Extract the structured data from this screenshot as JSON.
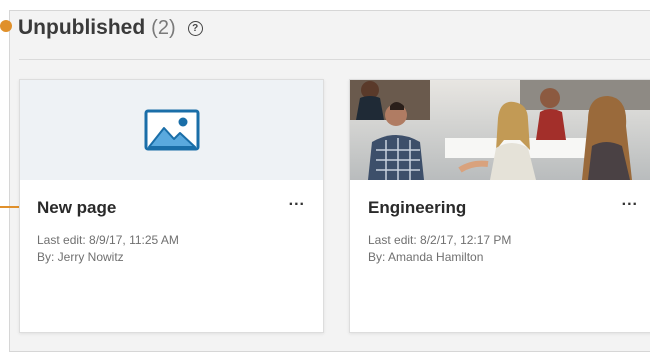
{
  "section": {
    "title": "Unpublished",
    "count": "(2)",
    "help_icon": "question-circle-icon"
  },
  "cards": [
    {
      "title": "New page",
      "last_edit": "Last edit: 8/9/17, 11:25 AM",
      "author": "By: Jerry Nowitz",
      "more": "...",
      "thumbnail_icon": "image-placeholder-icon"
    },
    {
      "title": "Engineering",
      "last_edit": "Last edit: 8/2/17, 12:17 PM",
      "author": "By: Amanda Hamilton",
      "more": "...",
      "thumbnail": "office-meeting-photo"
    }
  ],
  "colors": {
    "accent": "#e0902b",
    "icon_blue": "#1a6ea8"
  }
}
